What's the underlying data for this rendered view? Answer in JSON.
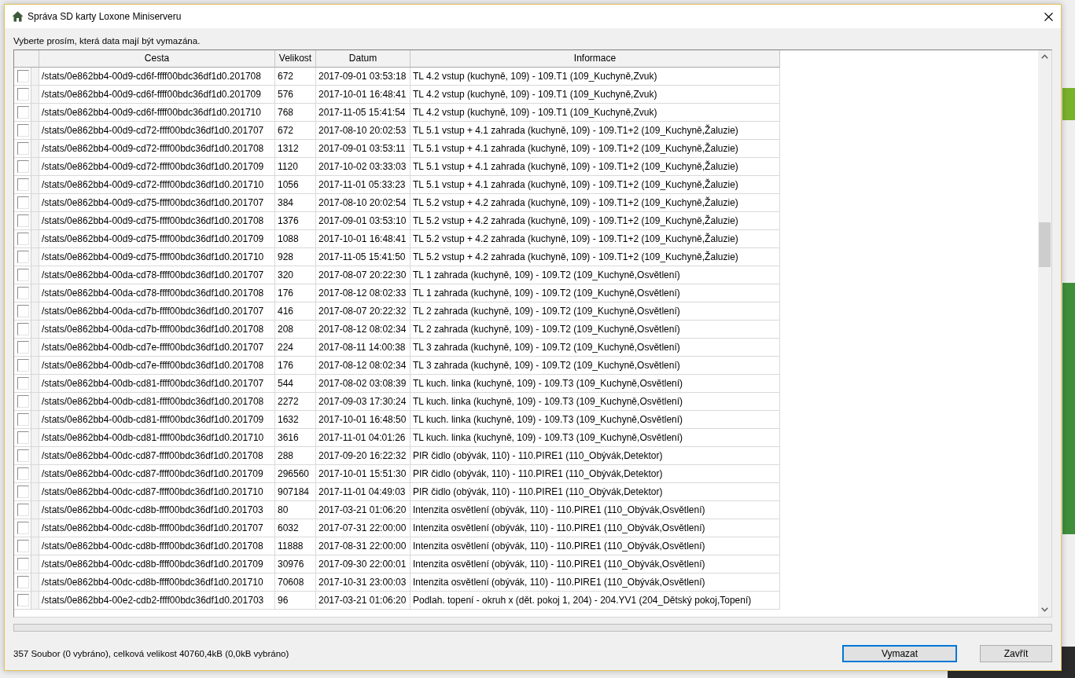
{
  "window": {
    "title": "Správa SD karty Loxone Miniserveru"
  },
  "instruction": "Vyberte prosím, která data mají být vymazána.",
  "table": {
    "columns": [
      "Cesta",
      "Velikost",
      "Datum",
      "Informace"
    ],
    "rows": [
      {
        "checked": false,
        "path": "/stats/0e862bb4-00d9-cd6f-ffff00bdc36df1d0.201708",
        "size": "672",
        "date": "2017-09-01 03:53:18",
        "info": "TL 4.2 vstup (kuchyně, 109) - 109.T1 (109_Kuchyně,Zvuk)"
      },
      {
        "checked": false,
        "path": "/stats/0e862bb4-00d9-cd6f-ffff00bdc36df1d0.201709",
        "size": "576",
        "date": "2017-10-01 16:48:41",
        "info": "TL 4.2 vstup (kuchyně, 109) - 109.T1 (109_Kuchyně,Zvuk)"
      },
      {
        "checked": false,
        "path": "/stats/0e862bb4-00d9-cd6f-ffff00bdc36df1d0.201710",
        "size": "768",
        "date": "2017-11-05 15:41:54",
        "info": "TL 4.2 vstup (kuchyně, 109) - 109.T1 (109_Kuchyně,Zvuk)"
      },
      {
        "checked": false,
        "path": "/stats/0e862bb4-00d9-cd72-ffff00bdc36df1d0.201707",
        "size": "672",
        "date": "2017-08-10 20:02:53",
        "info": "TL 5.1 vstup + 4.1 zahrada (kuchyně, 109) - 109.T1+2 (109_Kuchyně,Žaluzie)"
      },
      {
        "checked": false,
        "path": "/stats/0e862bb4-00d9-cd72-ffff00bdc36df1d0.201708",
        "size": "1312",
        "date": "2017-09-01 03:53:11",
        "info": "TL 5.1 vstup + 4.1 zahrada (kuchyně, 109) - 109.T1+2 (109_Kuchyně,Žaluzie)"
      },
      {
        "checked": false,
        "path": "/stats/0e862bb4-00d9-cd72-ffff00bdc36df1d0.201709",
        "size": "1120",
        "date": "2017-10-02 03:33:03",
        "info": "TL 5.1 vstup + 4.1 zahrada (kuchyně, 109) - 109.T1+2 (109_Kuchyně,Žaluzie)"
      },
      {
        "checked": false,
        "path": "/stats/0e862bb4-00d9-cd72-ffff00bdc36df1d0.201710",
        "size": "1056",
        "date": "2017-11-01 05:33:23",
        "info": "TL 5.1 vstup + 4.1 zahrada (kuchyně, 109) - 109.T1+2 (109_Kuchyně,Žaluzie)"
      },
      {
        "checked": false,
        "path": "/stats/0e862bb4-00d9-cd75-ffff00bdc36df1d0.201707",
        "size": "384",
        "date": "2017-08-10 20:02:54",
        "info": "TL 5.2 vstup + 4.2 zahrada (kuchyně, 109) - 109.T1+2 (109_Kuchyně,Žaluzie)"
      },
      {
        "checked": false,
        "path": "/stats/0e862bb4-00d9-cd75-ffff00bdc36df1d0.201708",
        "size": "1376",
        "date": "2017-09-01 03:53:10",
        "info": "TL 5.2 vstup + 4.2 zahrada (kuchyně, 109) - 109.T1+2 (109_Kuchyně,Žaluzie)"
      },
      {
        "checked": false,
        "path": "/stats/0e862bb4-00d9-cd75-ffff00bdc36df1d0.201709",
        "size": "1088",
        "date": "2017-10-01 16:48:41",
        "info": "TL 5.2 vstup + 4.2 zahrada (kuchyně, 109) - 109.T1+2 (109_Kuchyně,Žaluzie)"
      },
      {
        "checked": false,
        "path": "/stats/0e862bb4-00d9-cd75-ffff00bdc36df1d0.201710",
        "size": "928",
        "date": "2017-11-05 15:41:50",
        "info": "TL 5.2 vstup + 4.2 zahrada (kuchyně, 109) - 109.T1+2 (109_Kuchyně,Žaluzie)"
      },
      {
        "checked": false,
        "path": "/stats/0e862bb4-00da-cd78-ffff00bdc36df1d0.201707",
        "size": "320",
        "date": "2017-08-07 20:22:30",
        "info": "TL 1 zahrada (kuchyně, 109) - 109.T2 (109_Kuchyně,Osvětlení)"
      },
      {
        "checked": false,
        "path": "/stats/0e862bb4-00da-cd78-ffff00bdc36df1d0.201708",
        "size": "176",
        "date": "2017-08-12 08:02:33",
        "info": "TL 1 zahrada (kuchyně, 109) - 109.T2 (109_Kuchyně,Osvětlení)"
      },
      {
        "checked": false,
        "path": "/stats/0e862bb4-00da-cd7b-ffff00bdc36df1d0.201707",
        "size": "416",
        "date": "2017-08-07 20:22:32",
        "info": "TL 2 zahrada (kuchyně, 109) - 109.T2 (109_Kuchyně,Osvětlení)"
      },
      {
        "checked": false,
        "path": "/stats/0e862bb4-00da-cd7b-ffff00bdc36df1d0.201708",
        "size": "208",
        "date": "2017-08-12 08:02:34",
        "info": "TL 2 zahrada (kuchyně, 109) - 109.T2 (109_Kuchyně,Osvětlení)"
      },
      {
        "checked": false,
        "path": "/stats/0e862bb4-00db-cd7e-ffff00bdc36df1d0.201707",
        "size": "224",
        "date": "2017-08-11 14:00:38",
        "info": "TL 3 zahrada (kuchyně, 109) - 109.T2 (109_Kuchyně,Osvětlení)"
      },
      {
        "checked": false,
        "path": "/stats/0e862bb4-00db-cd7e-ffff00bdc36df1d0.201708",
        "size": "176",
        "date": "2017-08-12 08:02:34",
        "info": "TL 3 zahrada (kuchyně, 109) - 109.T2 (109_Kuchyně,Osvětlení)"
      },
      {
        "checked": false,
        "path": "/stats/0e862bb4-00db-cd81-ffff00bdc36df1d0.201707",
        "size": "544",
        "date": "2017-08-02 03:08:39",
        "info": "TL kuch. linka (kuchyně, 109) - 109.T3 (109_Kuchyně,Osvětlení)"
      },
      {
        "checked": false,
        "path": "/stats/0e862bb4-00db-cd81-ffff00bdc36df1d0.201708",
        "size": "2272",
        "date": "2017-09-03 17:30:24",
        "info": "TL kuch. linka (kuchyně, 109) - 109.T3 (109_Kuchyně,Osvětlení)"
      },
      {
        "checked": false,
        "path": "/stats/0e862bb4-00db-cd81-ffff00bdc36df1d0.201709",
        "size": "1632",
        "date": "2017-10-01 16:48:50",
        "info": "TL kuch. linka (kuchyně, 109) - 109.T3 (109_Kuchyně,Osvětlení)"
      },
      {
        "checked": false,
        "path": "/stats/0e862bb4-00db-cd81-ffff00bdc36df1d0.201710",
        "size": "3616",
        "date": "2017-11-01 04:01:26",
        "info": "TL kuch. linka (kuchyně, 109) - 109.T3 (109_Kuchyně,Osvětlení)"
      },
      {
        "checked": false,
        "path": "/stats/0e862bb4-00dc-cd87-ffff00bdc36df1d0.201708",
        "size": "288",
        "date": "2017-09-20 16:22:32",
        "info": "PIR čidlo (obývák, 110) - 110.PIRE1 (110_Obývák,Detektor)"
      },
      {
        "checked": false,
        "path": "/stats/0e862bb4-00dc-cd87-ffff00bdc36df1d0.201709",
        "size": "296560",
        "date": "2017-10-01 15:51:30",
        "info": "PIR čidlo (obývák, 110) - 110.PIRE1 (110_Obývák,Detektor)"
      },
      {
        "checked": false,
        "path": "/stats/0e862bb4-00dc-cd87-ffff00bdc36df1d0.201710",
        "size": "907184",
        "date": "2017-11-01 04:49:03",
        "info": "PIR čidlo (obývák, 110) - 110.PIRE1 (110_Obývák,Detektor)"
      },
      {
        "checked": false,
        "path": "/stats/0e862bb4-00dc-cd8b-ffff00bdc36df1d0.201703",
        "size": "80",
        "date": "2017-03-21 01:06:20",
        "info": "Intenzita osvětlení (obývák, 110) - 110.PIRE1 (110_Obývák,Osvětlení)"
      },
      {
        "checked": false,
        "path": "/stats/0e862bb4-00dc-cd8b-ffff00bdc36df1d0.201707",
        "size": "6032",
        "date": "2017-07-31 22:00:00",
        "info": "Intenzita osvětlení (obývák, 110) - 110.PIRE1 (110_Obývák,Osvětlení)"
      },
      {
        "checked": false,
        "path": "/stats/0e862bb4-00dc-cd8b-ffff00bdc36df1d0.201708",
        "size": "11888",
        "date": "2017-08-31 22:00:00",
        "info": "Intenzita osvětlení (obývák, 110) - 110.PIRE1 (110_Obývák,Osvětlení)"
      },
      {
        "checked": false,
        "path": "/stats/0e862bb4-00dc-cd8b-ffff00bdc36df1d0.201709",
        "size": "30976",
        "date": "2017-09-30 22:00:01",
        "info": "Intenzita osvětlení (obývák, 110) - 110.PIRE1 (110_Obývák,Osvětlení)"
      },
      {
        "checked": false,
        "path": "/stats/0e862bb4-00dc-cd8b-ffff00bdc36df1d0.201710",
        "size": "70608",
        "date": "2017-10-31 23:00:03",
        "info": "Intenzita osvětlení (obývák, 110) - 110.PIRE1 (110_Obývák,Osvětlení)"
      },
      {
        "checked": false,
        "path": "/stats/0e862bb4-00e2-cdb2-ffff00bdc36df1d0.201703",
        "size": "96",
        "date": "2017-03-21 01:06:20",
        "info": "Podlah. topení - okruh x (dět. pokoj 1, 204) - 204.YV1 (204_Dětský pokoj,Topení)"
      }
    ]
  },
  "progress": {
    "level": 0
  },
  "status": "357 Soubor (0 vybráno), celková velikost 40760,4kB (0,0kB vybráno)",
  "buttons": [
    {
      "label": "Vymazat",
      "focused": true
    },
    {
      "label": "Zavřít",
      "focused": false
    }
  ]
}
